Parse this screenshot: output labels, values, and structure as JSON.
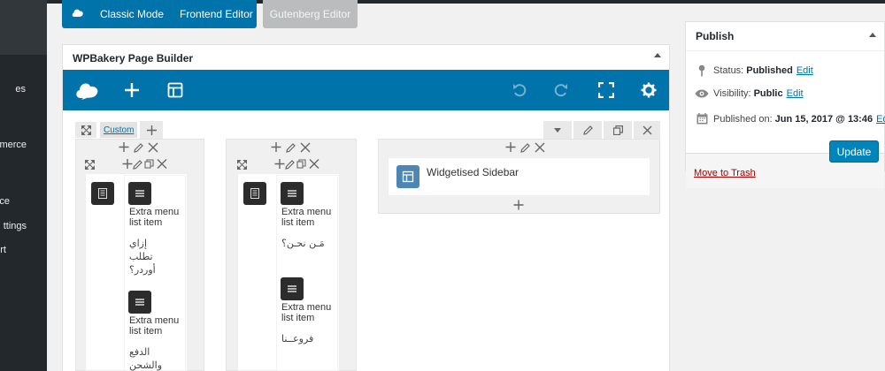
{
  "colors": {
    "accent": "#0073aa",
    "sidebar": "#23282d",
    "trash": "#a00"
  },
  "sidebar": {
    "items": [
      {
        "label": "es"
      },
      {
        "label": "merce"
      },
      {
        "label": "ce"
      },
      {
        "label": "ttings"
      },
      {
        "label": "rt"
      }
    ]
  },
  "editor_modes": {
    "classic_label": "Classic Mode",
    "frontend_label": "Frontend Editor",
    "gutenberg_label": "Gutenberg Editor"
  },
  "builder": {
    "title": "WPBakery Page Builder",
    "toolbar_icons": [
      "wpbakery-logo-icon",
      "add-element-icon",
      "templates-icon",
      "undo-icon",
      "redo-icon",
      "fullscreen-icon",
      "settings-icon"
    ],
    "row": {
      "custom_label": "Custom"
    },
    "columns": [
      {
        "elements": [
          {
            "label": "Extra menu list item",
            "text": "إزاي تطلب أوردر؟"
          },
          {
            "label": "Extra menu list item",
            "text": "الدفع والشحن"
          }
        ]
      },
      {
        "elements": [
          {
            "label": "Extra menu list item",
            "text": "مَـن نحـن؟"
          },
          {
            "label": "Extra menu list item",
            "text": "فروعــنا"
          }
        ]
      },
      {
        "elements": [
          {
            "label": "Widgetised Sidebar"
          }
        ]
      }
    ]
  },
  "publish": {
    "title": "Publish",
    "status_label": "Status:",
    "status_value": "Published",
    "visibility_label": "Visibility:",
    "visibility_value": "Public",
    "published_label": "Published on:",
    "published_value": "Jun 15, 2017 @ 13:46",
    "edit_label": "Edit",
    "trash_label": "Move to Trash",
    "update_label": "Update"
  }
}
